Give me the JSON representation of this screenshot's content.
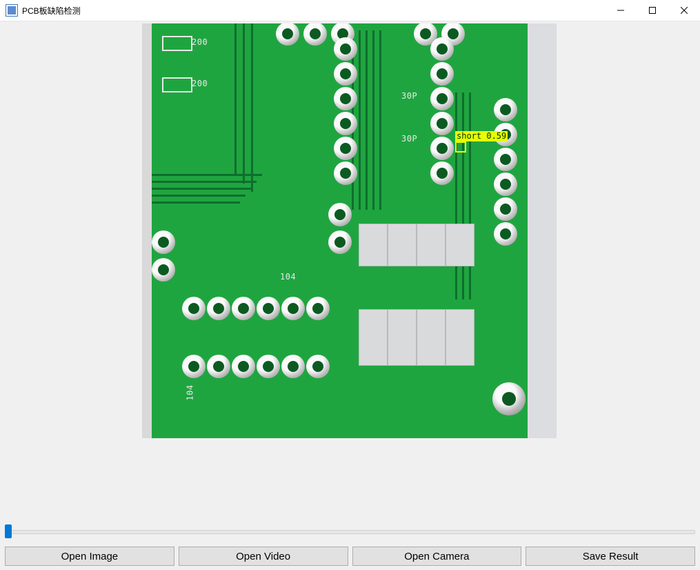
{
  "window": {
    "title": "PCB板缺陷检测"
  },
  "detection": {
    "label": "short 0.59"
  },
  "silk": {
    "r1": "200",
    "r2": "200",
    "c1": "30P",
    "c2": "30P",
    "c3": "104",
    "c4": "104"
  },
  "buttons": {
    "open_image": "Open Image",
    "open_video": "Open Video",
    "open_camera": "Open Camera",
    "save_result": "Save Result"
  }
}
